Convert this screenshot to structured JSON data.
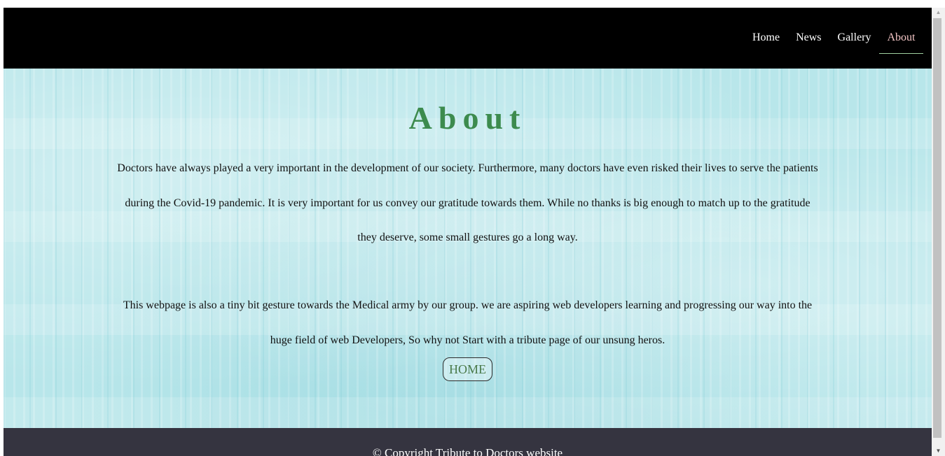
{
  "nav": {
    "items": [
      {
        "label": "Home"
      },
      {
        "label": "News"
      },
      {
        "label": "Gallery"
      },
      {
        "label": "About"
      }
    ]
  },
  "main": {
    "title": "About",
    "paragraph_1": "Doctors have always played a very important in the development of our society. Furthermore, many doctors have even risked their lives to serve the patients during the Covid-19 pandemic. It is very important for us convey our gratitude towards them. While no thanks is big enough to match up to the gratitude they deserve, some small gestures go a long way.",
    "paragraph_2": "This webpage is also a tiny bit gesture towards the Medical army by our group. we are aspiring web developers learning and progressing our way into the huge field of web Developers, So why not Start with a tribute page of our unsung heros.",
    "home_button": "HOME"
  },
  "footer": {
    "copyright": "© Copyright Tribute to Doctors website"
  },
  "scrollbar": {
    "up_arrow": "▲",
    "down_arrow": "▼"
  },
  "colors": {
    "nav_bg": "#000000",
    "nav_text": "#ffffff",
    "active_link": "#f4c6c6",
    "title": "#3d8b4e",
    "footer_bg": "#353440"
  }
}
